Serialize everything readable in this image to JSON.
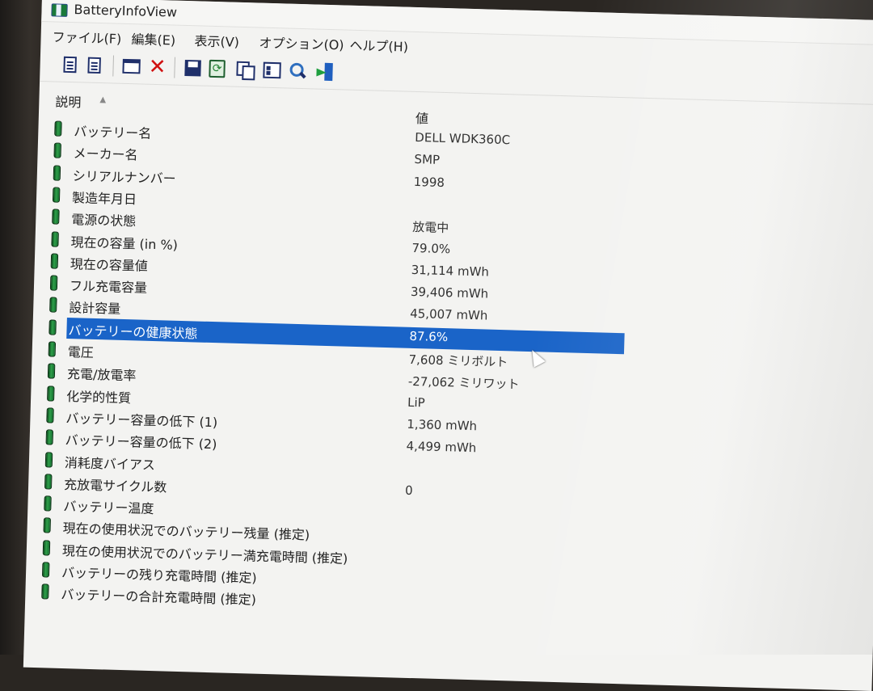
{
  "window": {
    "title": "BatteryInfoView"
  },
  "menu": [
    {
      "label": "ファイル(F)"
    },
    {
      "label": "編集(E)"
    },
    {
      "label": "表示(V)"
    },
    {
      "label": "オプション(O)"
    },
    {
      "label": "ヘルプ(H)"
    }
  ],
  "toolbar": {
    "icons": [
      "battery-info-view-icon",
      "log-view-icon",
      "advanced-options-icon",
      "clear-icon",
      "save-icon",
      "refresh-icon",
      "copy-icon",
      "properties-icon",
      "find-icon",
      "exit-icon"
    ]
  },
  "columns": {
    "description": "説明",
    "value": "値"
  },
  "rows": [
    {
      "label": "バッテリー名",
      "value": "DELL WDK360C"
    },
    {
      "label": "メーカー名",
      "value": "SMP"
    },
    {
      "label": "シリアルナンバー",
      "value": "1998"
    },
    {
      "label": "製造年月日",
      "value": ""
    },
    {
      "label": "電源の状態",
      "value": "放電中"
    },
    {
      "label": "現在の容量 (in %)",
      "value": "79.0%"
    },
    {
      "label": "現在の容量値",
      "value": "31,114 mWh"
    },
    {
      "label": "フル充電容量",
      "value": "39,406 mWh"
    },
    {
      "label": "設計容量",
      "value": "45,007 mWh"
    },
    {
      "label": "バッテリーの健康状態",
      "value": "87.6%",
      "selected": true
    },
    {
      "label": "電圧",
      "value": "7,608 ミリボルト"
    },
    {
      "label": "充電/放電率",
      "value": "-27,062 ミリワット"
    },
    {
      "label": "化学的性質",
      "value": "LiP"
    },
    {
      "label": "バッテリー容量の低下 (1)",
      "value": "1,360 mWh"
    },
    {
      "label": "バッテリー容量の低下 (2)",
      "value": "4,499 mWh"
    },
    {
      "label": "消耗度バイアス",
      "value": ""
    },
    {
      "label": "充放電サイクル数",
      "value": "0"
    },
    {
      "label": "バッテリー温度",
      "value": ""
    },
    {
      "label": "現在の使用状況でのバッテリー残量 (推定)",
      "value": ""
    },
    {
      "label": "現在の使用状況でのバッテリー満充電時間 (推定)",
      "value": ""
    },
    {
      "label": "バッテリーの残り充電時間 (推定)",
      "value": ""
    },
    {
      "label": "バッテリーの合計充電時間 (推定)",
      "value": ""
    }
  ],
  "colors": {
    "selection": "#1a64c8",
    "battery_icon": "#2fa04a"
  }
}
